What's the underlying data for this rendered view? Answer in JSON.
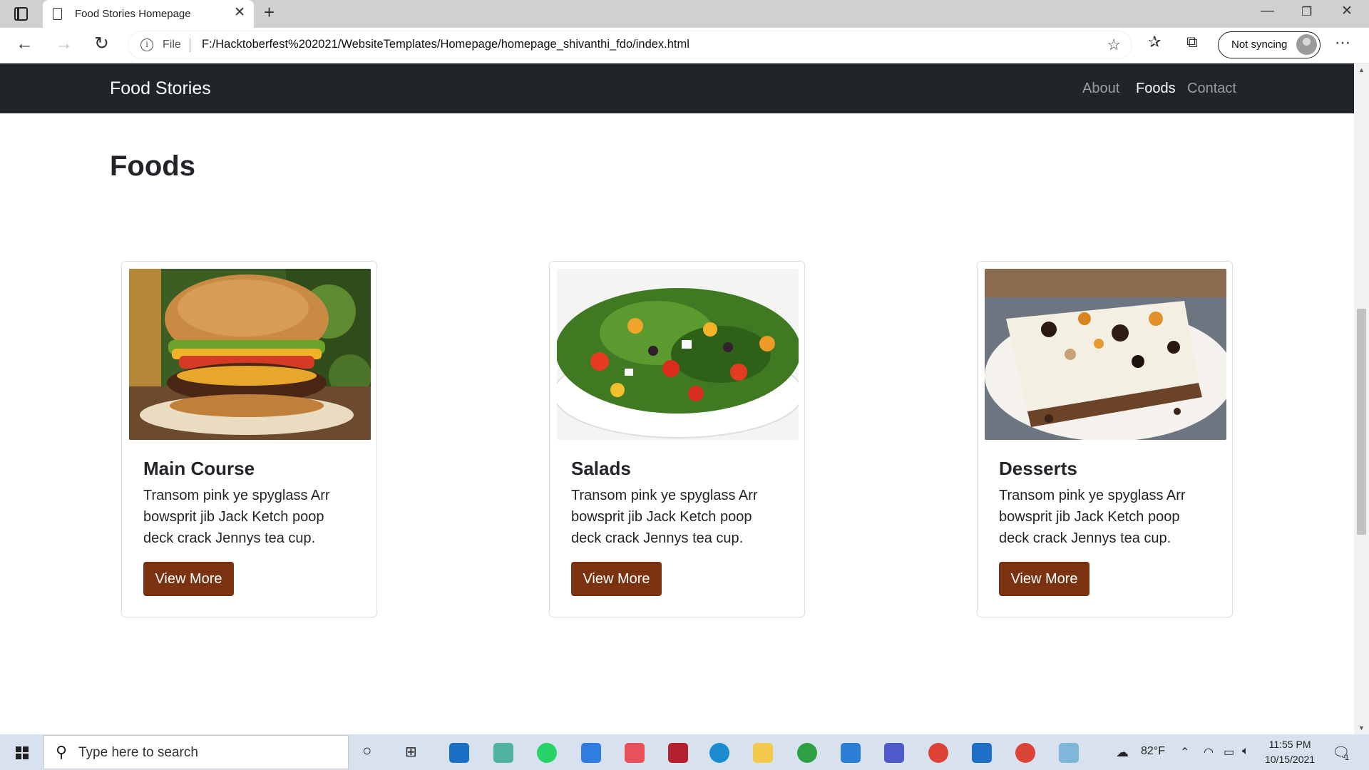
{
  "browser": {
    "tab_title": "Food Stories Homepage",
    "new_tab_label": "+",
    "file_label": "File",
    "url": "F:/Hacktoberfest%202021/WebsiteTemplates/Homepage/homepage_shivanthi_fdo/index.html",
    "sync_label": "Not syncing",
    "icons": [
      "tab-actions-icon",
      "page-icon",
      "close-icon",
      "back-icon",
      "forward-icon",
      "refresh-icon",
      "info-icon",
      "add-favorite-icon",
      "favorites-icon",
      "collections-icon",
      "profile-icon",
      "more-icon",
      "minimize-icon",
      "restore-icon",
      "window-close-icon"
    ]
  },
  "site": {
    "brand": "Food Stories",
    "nav": [
      {
        "label": "About",
        "active": false
      },
      {
        "label": "Foods",
        "active": true
      },
      {
        "label": "Contact",
        "active": false
      }
    ],
    "heading": "Foods",
    "cards": [
      {
        "title": "Main Course",
        "text": "Transom pink ye spyglass Arr bowsprit jib Jack Ketch poop deck crack Jennys tea cup.",
        "button": "View More",
        "image": "burger"
      },
      {
        "title": "Salads",
        "text": "Transom pink ye spyglass Arr bowsprit jib Jack Ketch poop deck crack Jennys tea cup.",
        "button": "View More",
        "image": "salad"
      },
      {
        "title": "Desserts",
        "text": "Transom pink ye spyglass Arr bowsprit jib Jack Ketch poop deck crack Jennys tea cup.",
        "button": "View More",
        "image": "dessert"
      }
    ],
    "colors": {
      "navbar": "#212529",
      "button": "#7a3210"
    }
  },
  "taskbar": {
    "search_placeholder": "Type here to search",
    "weather": "82°F",
    "time": "11:55 PM",
    "date": "10/15/2021",
    "notification_count": "1"
  }
}
